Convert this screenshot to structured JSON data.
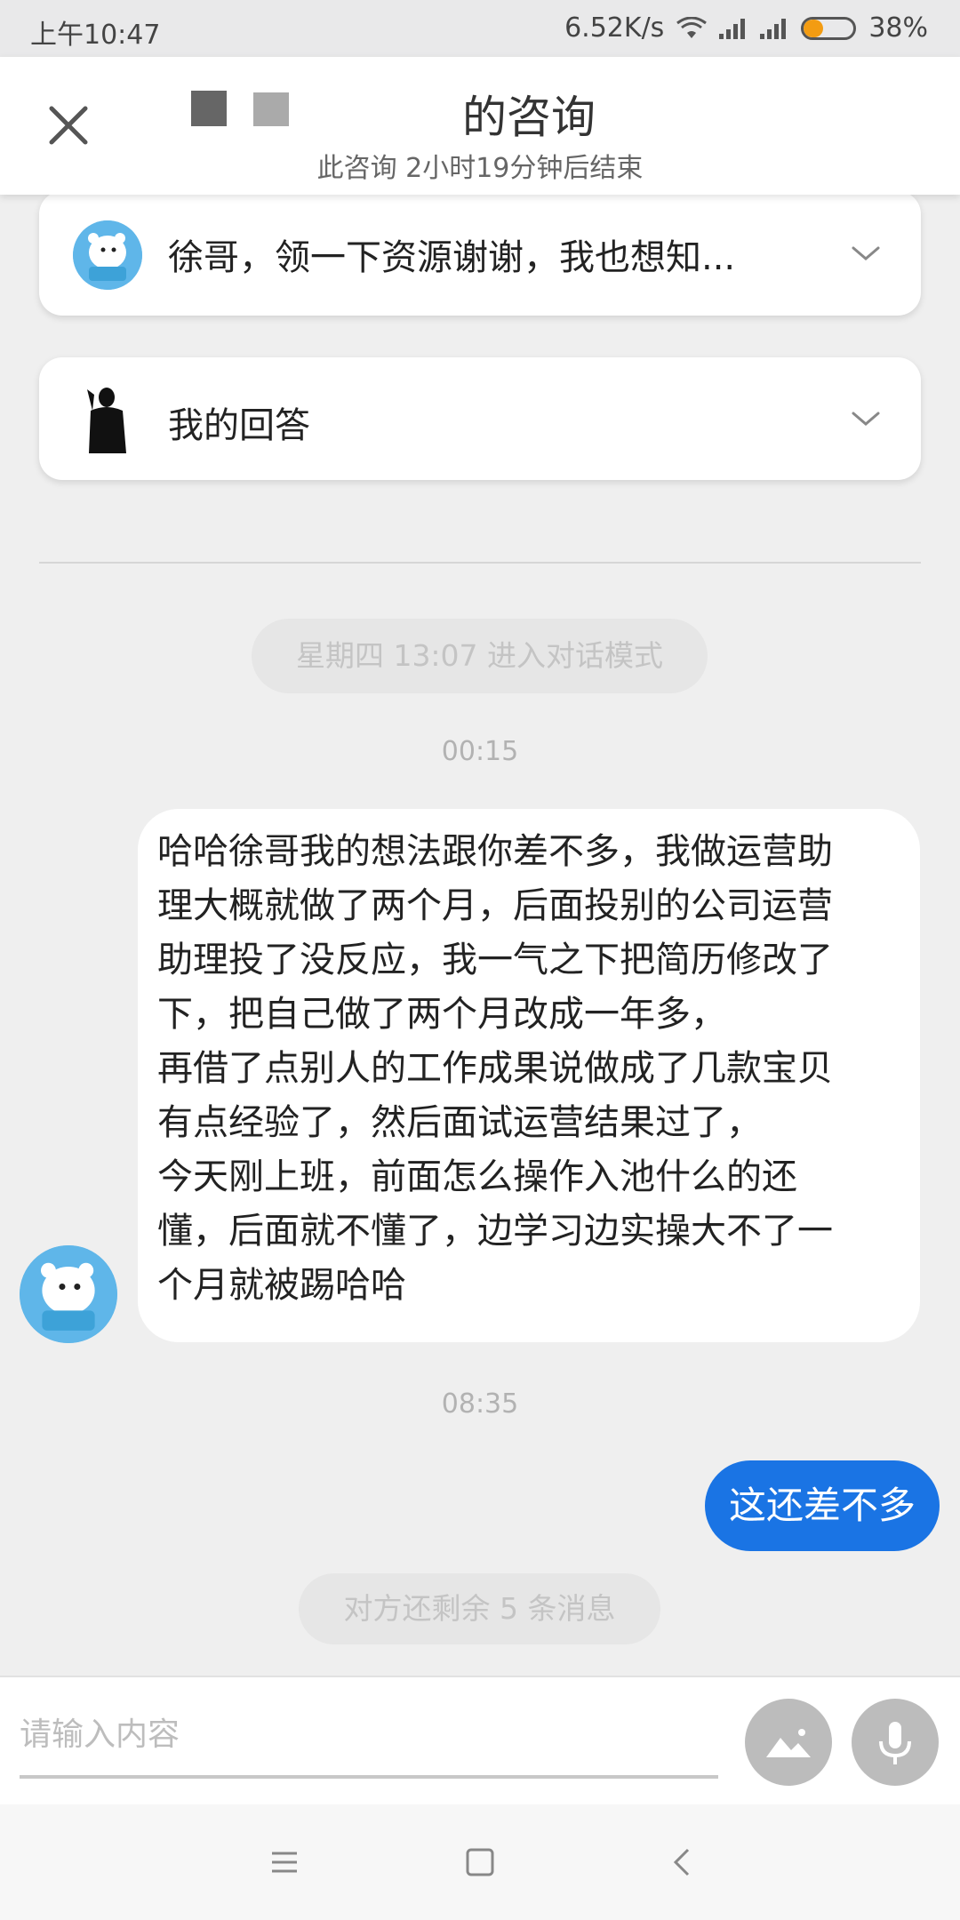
{
  "status_bar": {
    "time": "上午10:47",
    "speed": "6.52K/s",
    "battery_percent": "38%",
    "battery_level": 0.38
  },
  "header": {
    "title": "的咨询",
    "subtitle": "此咨询   2小时19分钟后结束"
  },
  "cards": [
    {
      "text": "徐哥，领一下资源谢谢，我也想知..."
    },
    {
      "text": "我的回答"
    }
  ],
  "conversation": {
    "mode_notice": "星期四 13:07 进入对话模式",
    "timestamp_1": "00:15",
    "message_in_lines": [
      "哈哈徐哥我的想法跟你差不多，我做运营助",
      "理大概就做了两个月，后面投别的公司运营",
      "助理投了没反应，我一气之下把简历修改了",
      "下，把自己做了两个月改成一年多，",
      "再借了点别人的工作成果说做成了几款宝贝",
      "有点经验了，然后面试运营结果过了，",
      "今天刚上班，前面怎么操作入池什么的还",
      "懂，后面就不懂了，边学习边实操大不了一",
      "个月就被踢哈哈"
    ],
    "timestamp_2": "08:35",
    "message_out": "这还差不多",
    "remaining_notice": "对方还剩余 5 条消息"
  },
  "input": {
    "placeholder": "请输入内容"
  },
  "icons": {
    "close": "close-icon",
    "chevron": "chevron-down-icon",
    "image": "image-icon",
    "mic": "microphone-icon",
    "menu": "menu-icon",
    "home": "home-icon",
    "back": "back-icon"
  },
  "colors": {
    "accent_blue": "#1a74e4",
    "battery_orange": "#f39c12"
  }
}
